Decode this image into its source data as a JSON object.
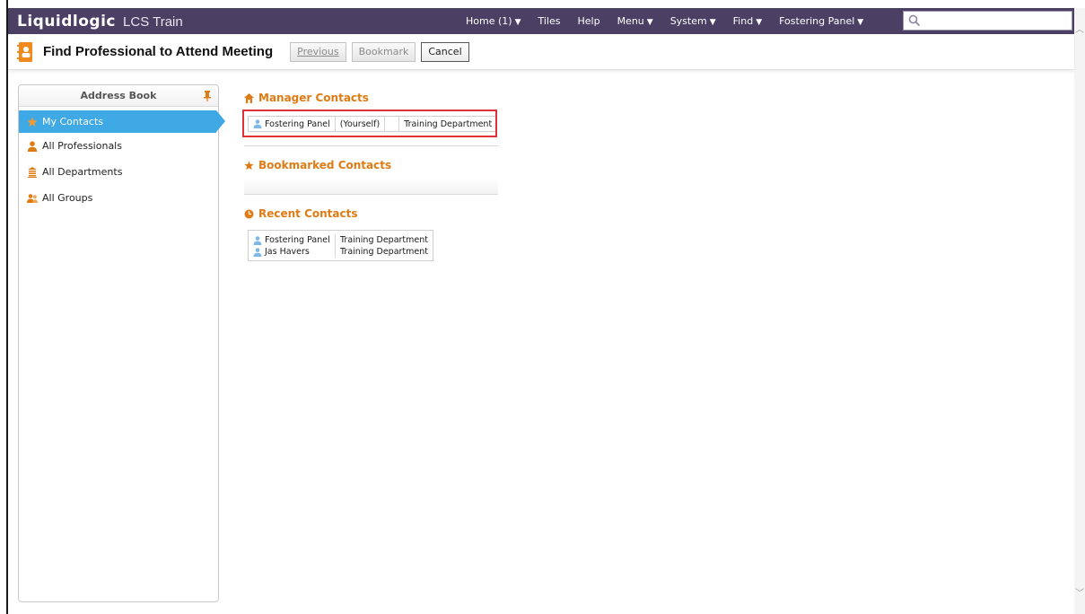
{
  "app": {
    "brand": "Liquidlogic",
    "name": "LCS Train"
  },
  "nav": [
    {
      "label": "Home (1)",
      "caret": true
    },
    {
      "label": "Tiles",
      "caret": false
    },
    {
      "label": "Help",
      "caret": false
    },
    {
      "label": "Menu",
      "caret": true
    },
    {
      "label": "System",
      "caret": true
    },
    {
      "label": "Find",
      "caret": true
    },
    {
      "label": "Fostering Panel",
      "caret": true
    }
  ],
  "search": {
    "value": ""
  },
  "page": {
    "title": "Find Professional to Attend Meeting"
  },
  "buttons": {
    "previous": "Previous",
    "bookmark": "Bookmark",
    "cancel": "Cancel"
  },
  "sidebar": {
    "title": "Address Book",
    "items": [
      {
        "label": "My Contacts",
        "icon": "star-icon"
      },
      {
        "label": "All Professionals",
        "icon": "person-icon"
      },
      {
        "label": "All Departments",
        "icon": "building-icon"
      },
      {
        "label": "All Groups",
        "icon": "group-icon"
      }
    ]
  },
  "sections": {
    "manager": {
      "heading": "Manager Contacts",
      "rows": [
        {
          "name": "Fostering Panel",
          "note": "(Yourself)",
          "department": "Training Department"
        }
      ]
    },
    "bookmarked": {
      "heading": "Bookmarked Contacts"
    },
    "recent": {
      "heading": "Recent Contacts",
      "rows": [
        {
          "name": "Fostering Panel",
          "department": "Training Department"
        },
        {
          "name": "Jas Havers",
          "department": "Training Department"
        }
      ]
    }
  },
  "colors": {
    "topbar": "#4b3f64",
    "accent_orange": "#e07b14",
    "active_blue": "#3fa9e6",
    "highlight_red": "#e0303a"
  }
}
